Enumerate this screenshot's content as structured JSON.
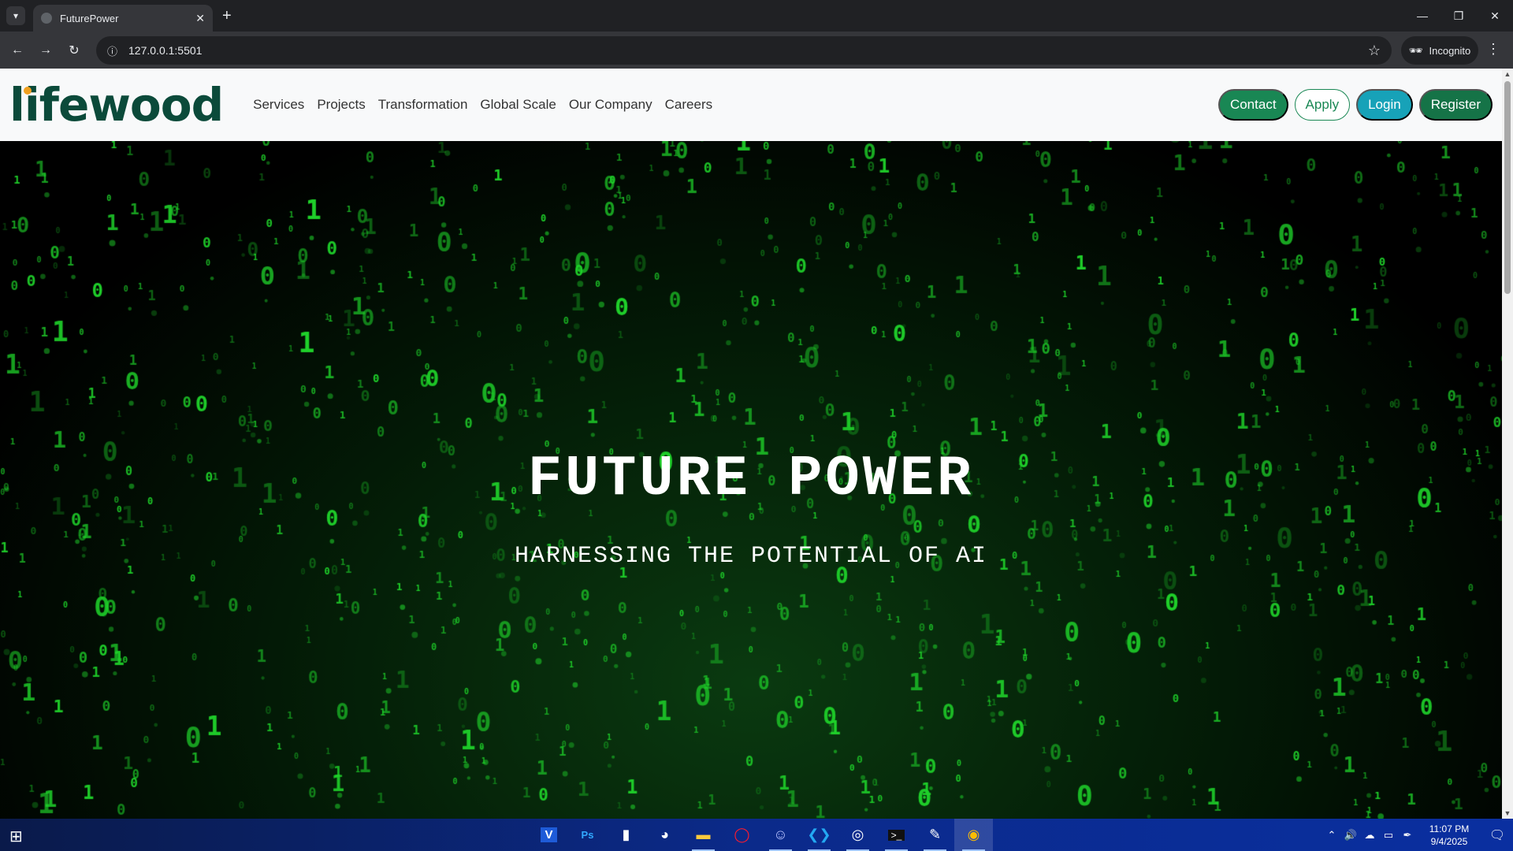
{
  "browser": {
    "tab_title": "FuturePower",
    "url": "127.0.0.1:5501",
    "incognito_label": "Incognito"
  },
  "site": {
    "logo": "lifewood",
    "nav": [
      "Services",
      "Projects",
      "Transformation",
      "Global Scale",
      "Our Company",
      "Careers"
    ],
    "buttons": {
      "contact": "Contact",
      "apply": "Apply",
      "login": "Login",
      "register": "Register"
    },
    "hero": {
      "title": "FUTURE POWER",
      "subtitle": "HARNESSING THE POTENTIAL OF AI"
    }
  },
  "taskbar": {
    "time": "11:07 PM",
    "date": "9/4/2025",
    "apps": [
      "V",
      "Ps",
      "mouse",
      "maps",
      "folder",
      "opera",
      "discord",
      "vscode",
      "steam",
      "terminal",
      "paint",
      "chrome"
    ]
  },
  "colors": {
    "brand_green": "#198754",
    "logo_green": "#0b4a3a",
    "matrix_green": "#1fd12a"
  }
}
